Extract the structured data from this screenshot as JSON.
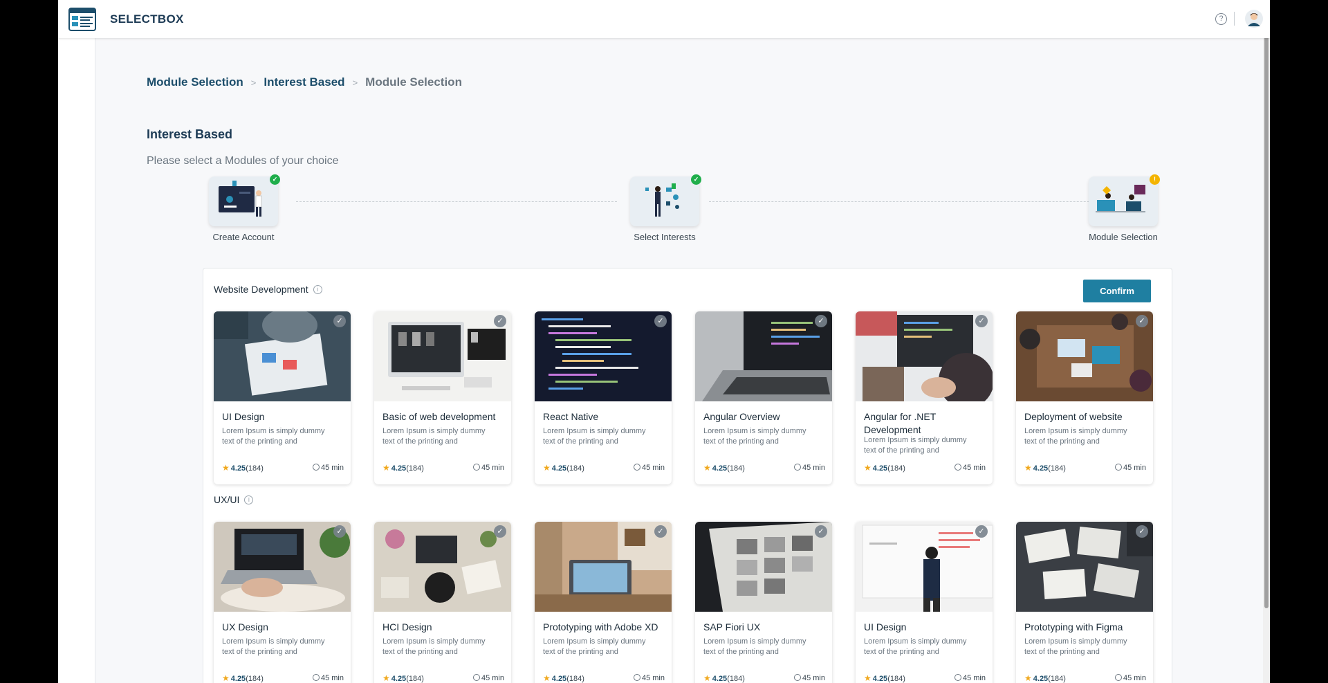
{
  "app": {
    "brand": "SELECTBOX"
  },
  "breadcrumb": [
    "Module Selection",
    "Interest Based",
    "Module Selection"
  ],
  "page": {
    "title": "Interest Based",
    "subtitle": "Please select a Modules of your choice"
  },
  "steps": [
    {
      "label": "Create Account",
      "status": "complete"
    },
    {
      "label": "Select Interests",
      "status": "complete"
    },
    {
      "label": "Module Selection",
      "status": "pending"
    }
  ],
  "confirm_label": "Confirm",
  "sections": [
    {
      "title": "Website Development",
      "cards": [
        {
          "title": "UI Design",
          "desc": "Lorem Ipsum is simply dummy text of the printing and",
          "rating": "4.25",
          "reviews": "(184)",
          "duration": "45 min"
        },
        {
          "title": "Basic of web development",
          "desc": "Lorem Ipsum is simply dummy text of the printing and",
          "rating": "4.25",
          "reviews": "(184)",
          "duration": "45 min"
        },
        {
          "title": "React Native",
          "desc": "Lorem Ipsum is simply dummy text of the printing and",
          "rating": "4.25",
          "reviews": "(184)",
          "duration": "45 min"
        },
        {
          "title": "Angular Overview",
          "desc": "Lorem Ipsum is simply dummy text of the printing and",
          "rating": "4.25",
          "reviews": "(184)",
          "duration": "45 min"
        },
        {
          "title": "Angular for .NET Development",
          "desc": "Lorem Ipsum is simply dummy text of the printing and",
          "rating": "4.25",
          "reviews": "(184)",
          "duration": "45 min"
        },
        {
          "title": "Deployment of website",
          "desc": "Lorem Ipsum is simply dummy text of the printing and",
          "rating": "4.25",
          "reviews": "(184)",
          "duration": "45 min"
        }
      ]
    },
    {
      "title": "UX/UI",
      "cards": [
        {
          "title": "UX Design",
          "desc": "Lorem Ipsum is simply dummy text of the printing and",
          "rating": "4.25",
          "reviews": "(184)",
          "duration": "45 min"
        },
        {
          "title": "HCI Design",
          "desc": "Lorem Ipsum is simply dummy text of the printing and",
          "rating": "4.25",
          "reviews": "(184)",
          "duration": "45 min"
        },
        {
          "title": "Prototyping with Adobe XD",
          "desc": "Lorem Ipsum is simply dummy text of the printing and",
          "rating": "4.25",
          "reviews": "(184)",
          "duration": "45 min"
        },
        {
          "title": "SAP Fiori UX",
          "desc": "Lorem Ipsum is simply dummy text of the printing and",
          "rating": "4.25",
          "reviews": "(184)",
          "duration": "45 min"
        },
        {
          "title": "UI Design",
          "desc": "Lorem Ipsum is simply dummy text of the printing and",
          "rating": "4.25",
          "reviews": "(184)",
          "duration": "45 min"
        },
        {
          "title": "Prototyping with Figma",
          "desc": "Lorem Ipsum is simply dummy text of the printing and",
          "rating": "4.25",
          "reviews": "(184)",
          "duration": "45 min"
        }
      ]
    }
  ],
  "icons": {
    "help": "help-circle-icon",
    "info": "info-icon",
    "check": "check-icon",
    "star": "star-icon",
    "clock": "clock-icon"
  },
  "colors": {
    "accent": "#1f7fa1",
    "brand_text": "#1d3b55",
    "step_complete": "#1fae4b",
    "step_pending": "#f4b400",
    "star": "#f0a81d"
  }
}
